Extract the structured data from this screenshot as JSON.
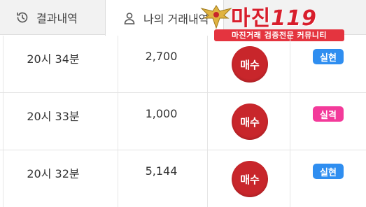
{
  "tabs": [
    {
      "label": "결과내역",
      "icon": "history-icon"
    },
    {
      "label": "나의 거래내역",
      "icon": "user-icon"
    }
  ],
  "watermark": {
    "brand": "마진",
    "brand_num": "119",
    "tagline": "마진거래 검증전문 커뮤니티"
  },
  "colors": {
    "buy": "#c8262b",
    "realized": "#2f8ef0",
    "failed": "#f33a9a"
  },
  "rows": [
    {
      "time": "20시 34분",
      "amount": "2,700",
      "action": "매수",
      "result": "실현",
      "result_type": "realized"
    },
    {
      "time": "20시 33분",
      "amount": "1,000",
      "action": "매수",
      "result": "실격",
      "result_type": "failed"
    },
    {
      "time": "20시 32분",
      "amount": "5,144",
      "action": "매수",
      "result": "실현",
      "result_type": "realized"
    }
  ]
}
